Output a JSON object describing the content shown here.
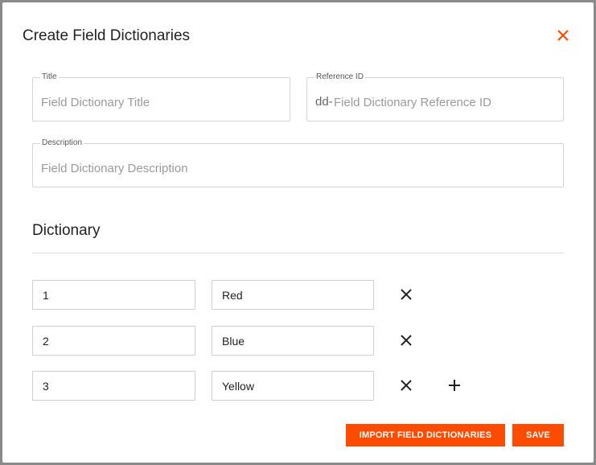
{
  "dialog": {
    "title": "Create Field Dictionaries",
    "close_icon": "close-icon"
  },
  "form": {
    "title": {
      "label": "Title",
      "placeholder": "Field Dictionary Title",
      "value": ""
    },
    "reference_id": {
      "label": "Reference ID",
      "prefix": "dd-",
      "placeholder": "Field Dictionary Reference ID",
      "value": ""
    },
    "description": {
      "label": "Description",
      "placeholder": "Field Dictionary Description",
      "value": ""
    }
  },
  "dictionary": {
    "section_title": "Dictionary",
    "entries": [
      {
        "key": "1",
        "value": "Red"
      },
      {
        "key": "2",
        "value": "Blue"
      },
      {
        "key": "3",
        "value": "Yellow"
      }
    ]
  },
  "actions": {
    "import_label": "IMPORT FIELD DICTIONARIES",
    "save_label": "SAVE"
  },
  "colors": {
    "accent": "#fc4c02",
    "backdrop": "#8a8a8a"
  }
}
